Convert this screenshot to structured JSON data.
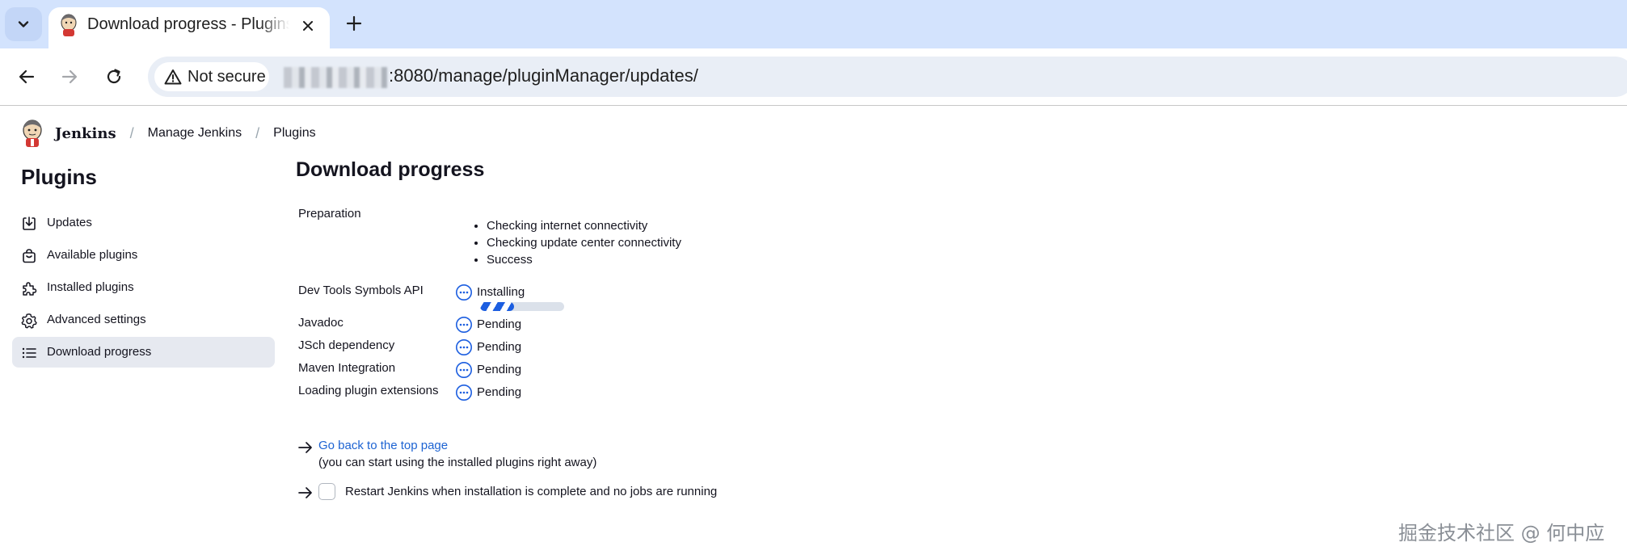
{
  "browser": {
    "tab_title": "Download progress - Plugins",
    "security_label": "Not secure",
    "url_path": ":8080/manage/pluginManager/updates/"
  },
  "breadcrumbs": {
    "brand": "Jenkins",
    "items": [
      "Manage Jenkins",
      "Plugins"
    ]
  },
  "sidebar": {
    "title": "Plugins",
    "items": [
      {
        "label": "Updates",
        "icon": "download-box-icon"
      },
      {
        "label": "Available plugins",
        "icon": "shopping-bag-icon"
      },
      {
        "label": "Installed plugins",
        "icon": "puzzle-icon"
      },
      {
        "label": "Advanced settings",
        "icon": "gear-icon"
      },
      {
        "label": "Download progress",
        "icon": "list-icon",
        "active": true
      }
    ]
  },
  "main": {
    "title": "Download progress",
    "preparation": {
      "label": "Preparation",
      "steps": [
        "Checking internet connectivity",
        "Checking update center connectivity",
        "Success"
      ]
    },
    "jobs": [
      {
        "name": "Dev Tools Symbols API",
        "status": "Installing",
        "progress": 0.4
      },
      {
        "name": "Javadoc",
        "status": "Pending"
      },
      {
        "name": "JSch dependency",
        "status": "Pending"
      },
      {
        "name": "Maven Integration",
        "status": "Pending"
      },
      {
        "name": "Loading plugin extensions",
        "status": "Pending"
      }
    ],
    "top_link": "Go back to the top page",
    "top_link_note": "(you can start using the installed plugins right away)",
    "restart_label": "Restart Jenkins when installation is complete and no jobs are running",
    "restart_checked": false
  },
  "watermark": "掘金技术社区 @ 何中应",
  "colors": {
    "accent": "#1d63d2",
    "status_icon": "#1c5ee0",
    "tabstrip": "#d3e3fd",
    "active_item_bg": "#e6e9f0"
  }
}
